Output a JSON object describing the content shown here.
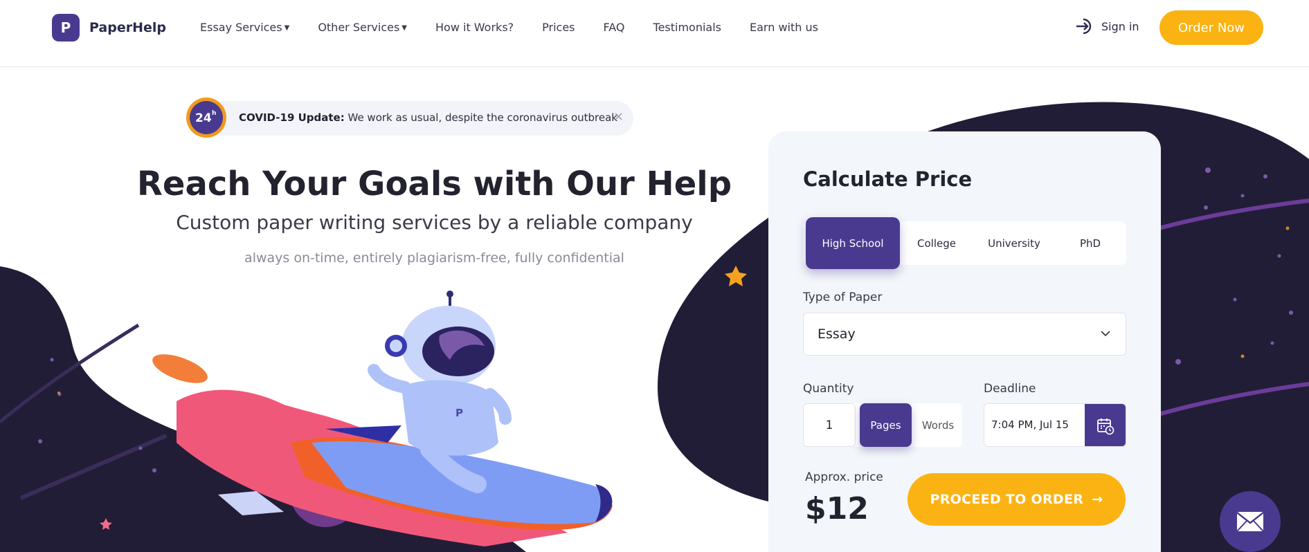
{
  "header": {
    "logo_text": "PaperHelp",
    "logo_letter": "P",
    "nav": [
      {
        "label": "Essay Services",
        "has_caret": true
      },
      {
        "label": "Other Services",
        "has_caret": true
      },
      {
        "label": "How it Works?"
      },
      {
        "label": "Prices"
      },
      {
        "label": "FAQ"
      },
      {
        "label": "Testimonials"
      },
      {
        "label": "Earn with us"
      }
    ],
    "signin_label": "Sign in",
    "order_now_label": "Order Now"
  },
  "covid": {
    "badge_text": "24",
    "badge_sup": "h",
    "title": "COVID-19 Update:",
    "message": " We work as usual, despite the coronavirus outbreak",
    "close": "×"
  },
  "hero": {
    "title": "Reach Your Goals with Our Help",
    "subtitle": "Custom paper writing services by a reliable company",
    "tagline": "always on-time, entirely plagiarism-free, fully confidential"
  },
  "calculator": {
    "title": "Calculate Price",
    "levels": [
      "High School",
      "College",
      "University",
      "PhD"
    ],
    "active_level": "High School",
    "type_label": "Type of Paper",
    "type_value": "Essay",
    "quantity_label": "Quantity",
    "quantity_value": "1",
    "unit_pages": "Pages",
    "unit_words": "Words",
    "deadline_label": "Deadline",
    "deadline_value": "7:04 PM, Jul 15",
    "approx_label": "Approx. price",
    "price": "$12",
    "proceed_label": "PROCEED TO ORDER",
    "proceed_arrow": "→"
  },
  "colors": {
    "brand_purple": "#4a3a8f",
    "accent_yellow": "#fbb313",
    "space_dark": "#221d36"
  },
  "icons": [
    "sign-in-icon",
    "chevron-down-icon",
    "calendar-clock-icon",
    "mail-icon",
    "close-icon"
  ]
}
